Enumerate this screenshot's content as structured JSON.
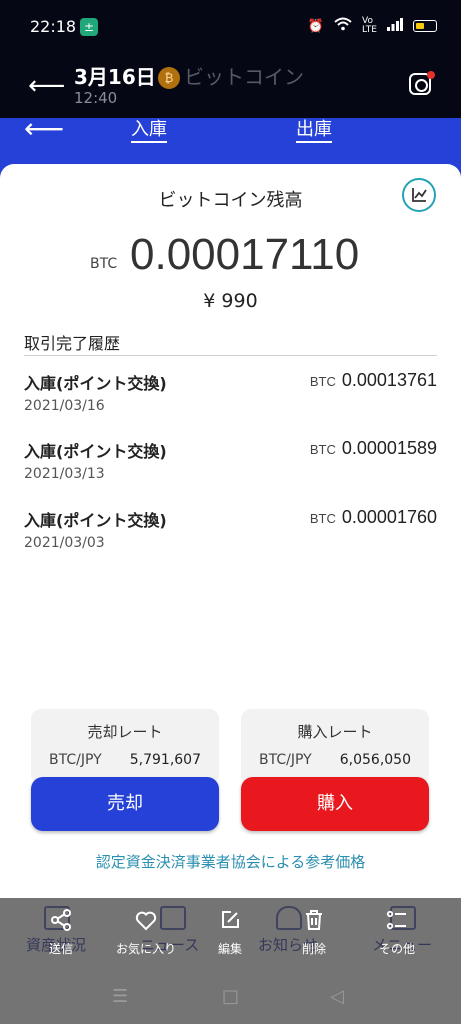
{
  "status_bar": {
    "time": "22:18",
    "app_notification": "±",
    "icons": [
      "alarm-icon",
      "wifi-icon",
      "volte-icon",
      "signal-icon",
      "battery-icon"
    ]
  },
  "viewer": {
    "date": "3月16日",
    "time": "12:40",
    "underlying_title": "ビットコイン"
  },
  "app_nav": {
    "deposit_tab": "入庫",
    "withdraw_tab": "出庫"
  },
  "balance": {
    "title": "ビットコイン残高",
    "unit": "BTC",
    "amount": "0.00017110",
    "jpy": "¥ 990"
  },
  "history": {
    "label": "取引完了履歴",
    "items": [
      {
        "title": "入庫(ポイント交換)",
        "date": "2021/03/16",
        "unit": "BTC",
        "amount": "0.00013761"
      },
      {
        "title": "入庫(ポイント交換)",
        "date": "2021/03/13",
        "unit": "BTC",
        "amount": "0.00001589"
      },
      {
        "title": "入庫(ポイント交換)",
        "date": "2021/03/03",
        "unit": "BTC",
        "amount": "0.00001760"
      }
    ]
  },
  "rates": {
    "sell": {
      "title": "売却レート",
      "pair": "BTC/JPY",
      "value": "5,791,607"
    },
    "buy": {
      "title": "購入レート",
      "pair": "BTC/JPY",
      "value": "6,056,050"
    }
  },
  "actions": {
    "sell_label": "売却",
    "buy_label": "購入",
    "sell_color": "#2541d8",
    "buy_color": "#e8181e"
  },
  "reference_link": "認定資金決済事業者協会による参考価格",
  "underlying_tabs": [
    "資産状況",
    "ニュース",
    "お知らせ",
    "メニュー"
  ],
  "toolbar": {
    "share": "送信",
    "favorite": "お気に入り",
    "edit": "編集",
    "delete": "削除",
    "more": "その他"
  },
  "system_nav": {
    "menu": "☰",
    "home": "□",
    "back": "◁"
  }
}
